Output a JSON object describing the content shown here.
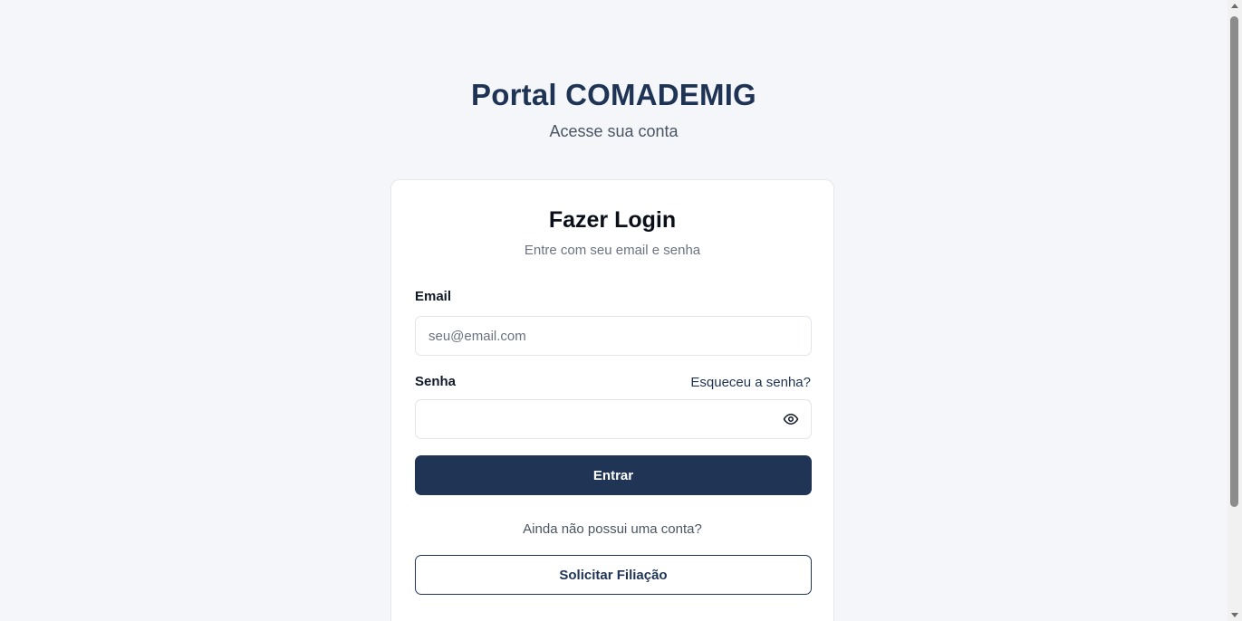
{
  "header": {
    "title": "Portal COMADEMIG",
    "subtitle": "Acesse sua conta"
  },
  "login_card": {
    "title": "Fazer Login",
    "subtitle": "Entre com seu email e senha",
    "email": {
      "label": "Email",
      "placeholder": "seu@email.com",
      "value": ""
    },
    "password": {
      "label": "Senha",
      "value": "",
      "toggle_icon": "eye-icon"
    },
    "forgot_link": "Esqueceu a senha?",
    "submit_label": "Entrar",
    "signup_prompt": "Ainda não possui uma conta?",
    "signup_button": "Solicitar Filiação"
  },
  "colors": {
    "brand": "#1f3354",
    "primary_button": "#203556",
    "background": "#f4f6f9"
  }
}
